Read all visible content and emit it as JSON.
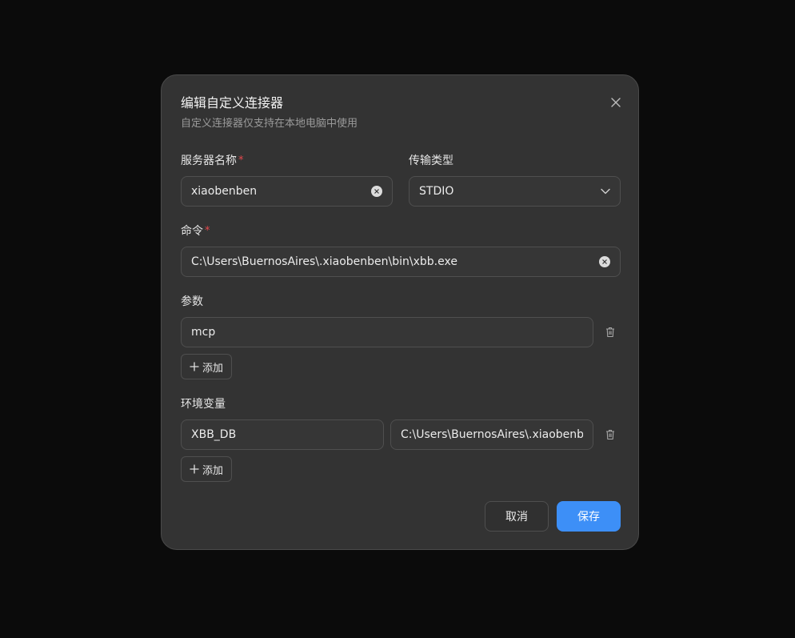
{
  "dialog": {
    "title": "编辑自定义连接器",
    "subtitle": "自定义连接器仅支持在本地电脑中使用"
  },
  "fields": {
    "server_name": {
      "label": "服务器名称",
      "required_mark": "*",
      "value": "xiaobenben"
    },
    "transport_type": {
      "label": "传输类型",
      "value": "STDIO"
    },
    "command": {
      "label": "命令",
      "required_mark": "*",
      "value": "C:\\Users\\BuernosAires\\.xiaobenben\\bin\\xbb.exe"
    },
    "args": {
      "label": "参数",
      "items": [
        "mcp"
      ],
      "add_label": "添加"
    },
    "env": {
      "label": "环境变量",
      "items": [
        {
          "key": "XBB_DB",
          "value": "C:\\Users\\BuernosAires\\.xiaobenben"
        }
      ],
      "add_label": "添加"
    }
  },
  "actions": {
    "cancel_label": "取消",
    "save_label": "保存"
  },
  "colors": {
    "accent": "#3d8ff7",
    "required": "#e5484d",
    "dialog_bg": "#333333",
    "page_bg": "#0b0b0b"
  },
  "icons": {
    "close": "close-icon",
    "clear": "clear-icon",
    "chevron": "chevron-down-icon",
    "delete": "trash-icon",
    "add": "plus-icon"
  }
}
